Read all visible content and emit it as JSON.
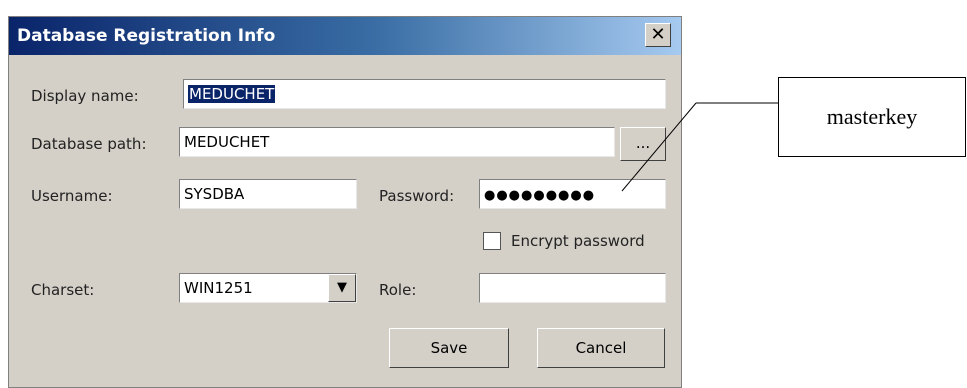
{
  "dialog": {
    "title": "Database Registration Info",
    "close_glyph": "✕",
    "fields": {
      "display_name": {
        "label": "Display name:",
        "value": "MEDUCHET"
      },
      "database_path": {
        "label": "Database path:",
        "value": "MEDUCHET",
        "browse_label": "..."
      },
      "username": {
        "label": "Username:",
        "value": "SYSDBA"
      },
      "password": {
        "label": "Password:",
        "value": "●●●●●●●●●"
      },
      "encrypt": {
        "label": "Encrypt password",
        "checked": false
      },
      "charset": {
        "label": "Charset:",
        "value": "WIN1251"
      },
      "role": {
        "label": "Role:",
        "value": ""
      }
    },
    "buttons": {
      "save": "Save",
      "cancel": "Cancel"
    }
  },
  "annotation": {
    "text": "masterkey"
  },
  "icons": {
    "close": "close-icon",
    "dropdown": "chevron-down-icon"
  }
}
